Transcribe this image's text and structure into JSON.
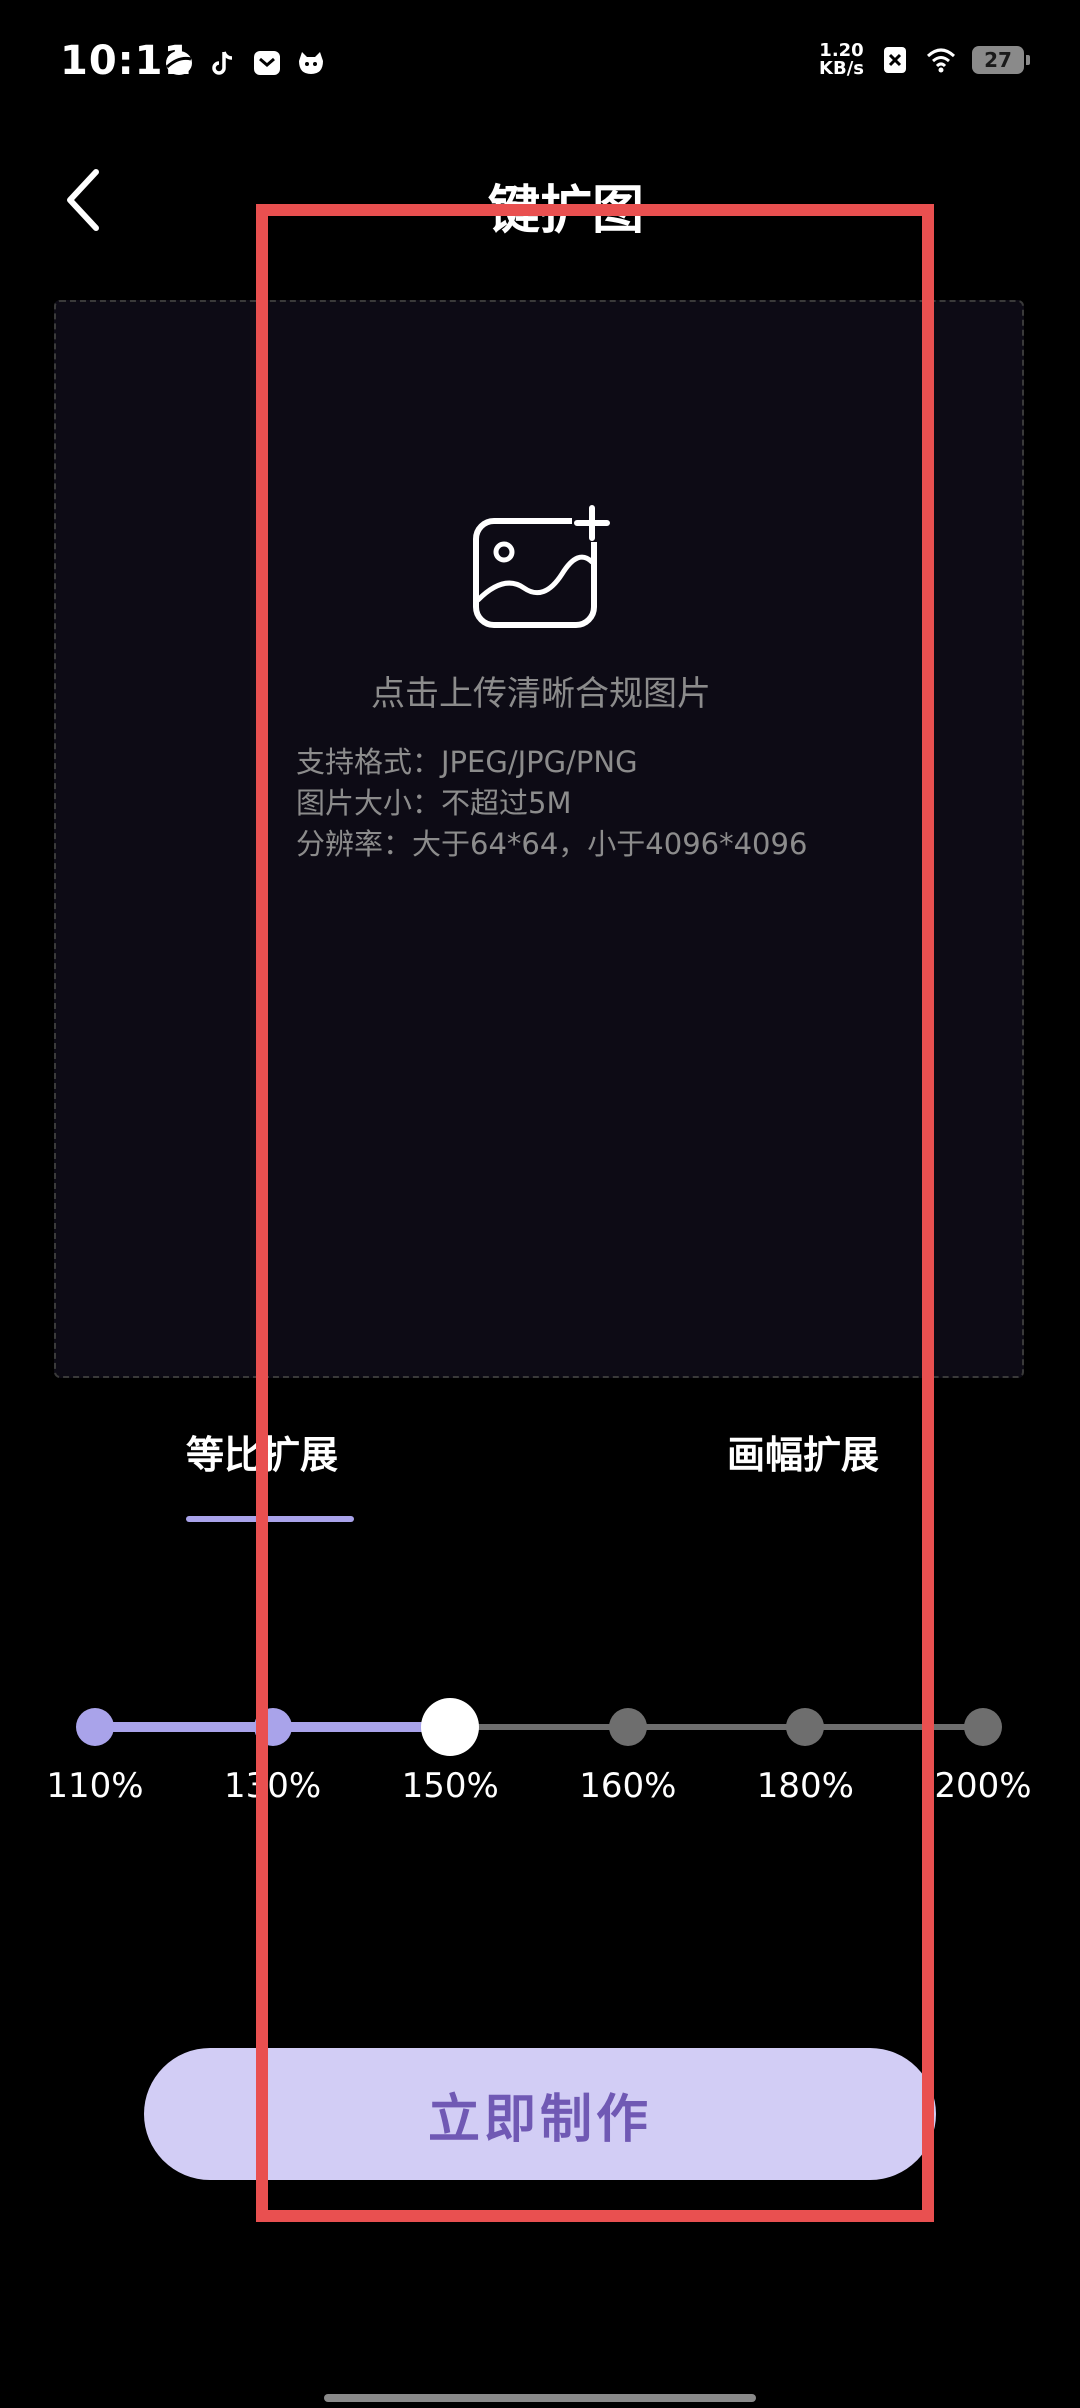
{
  "status_bar": {
    "time": "10:11",
    "net_speed_value": "1.20",
    "net_speed_unit": "KB/s",
    "battery": "27"
  },
  "header": {
    "title": "一键扩图"
  },
  "upload": {
    "hint": "点击上传清晰合规图片",
    "specs": [
      "支持格式：JPEG/JPG/PNG",
      "图片大小：不超过5M",
      "分辨率：大于64*64，小于4096*4096"
    ]
  },
  "tabs": [
    {
      "label": "等比扩展",
      "selected": true
    },
    {
      "label": "画幅扩展",
      "selected": false
    }
  ],
  "scale_slider": {
    "stops": [
      "110%",
      "130%",
      "150%",
      "160%",
      "180%",
      "200%"
    ],
    "selected": "150%"
  },
  "action": {
    "label": "立即制作"
  },
  "colors": {
    "accent": "#a9a3ea",
    "button_bg": "#d2cdf5",
    "button_text": "#7059b4",
    "highlight": "#e95050"
  }
}
